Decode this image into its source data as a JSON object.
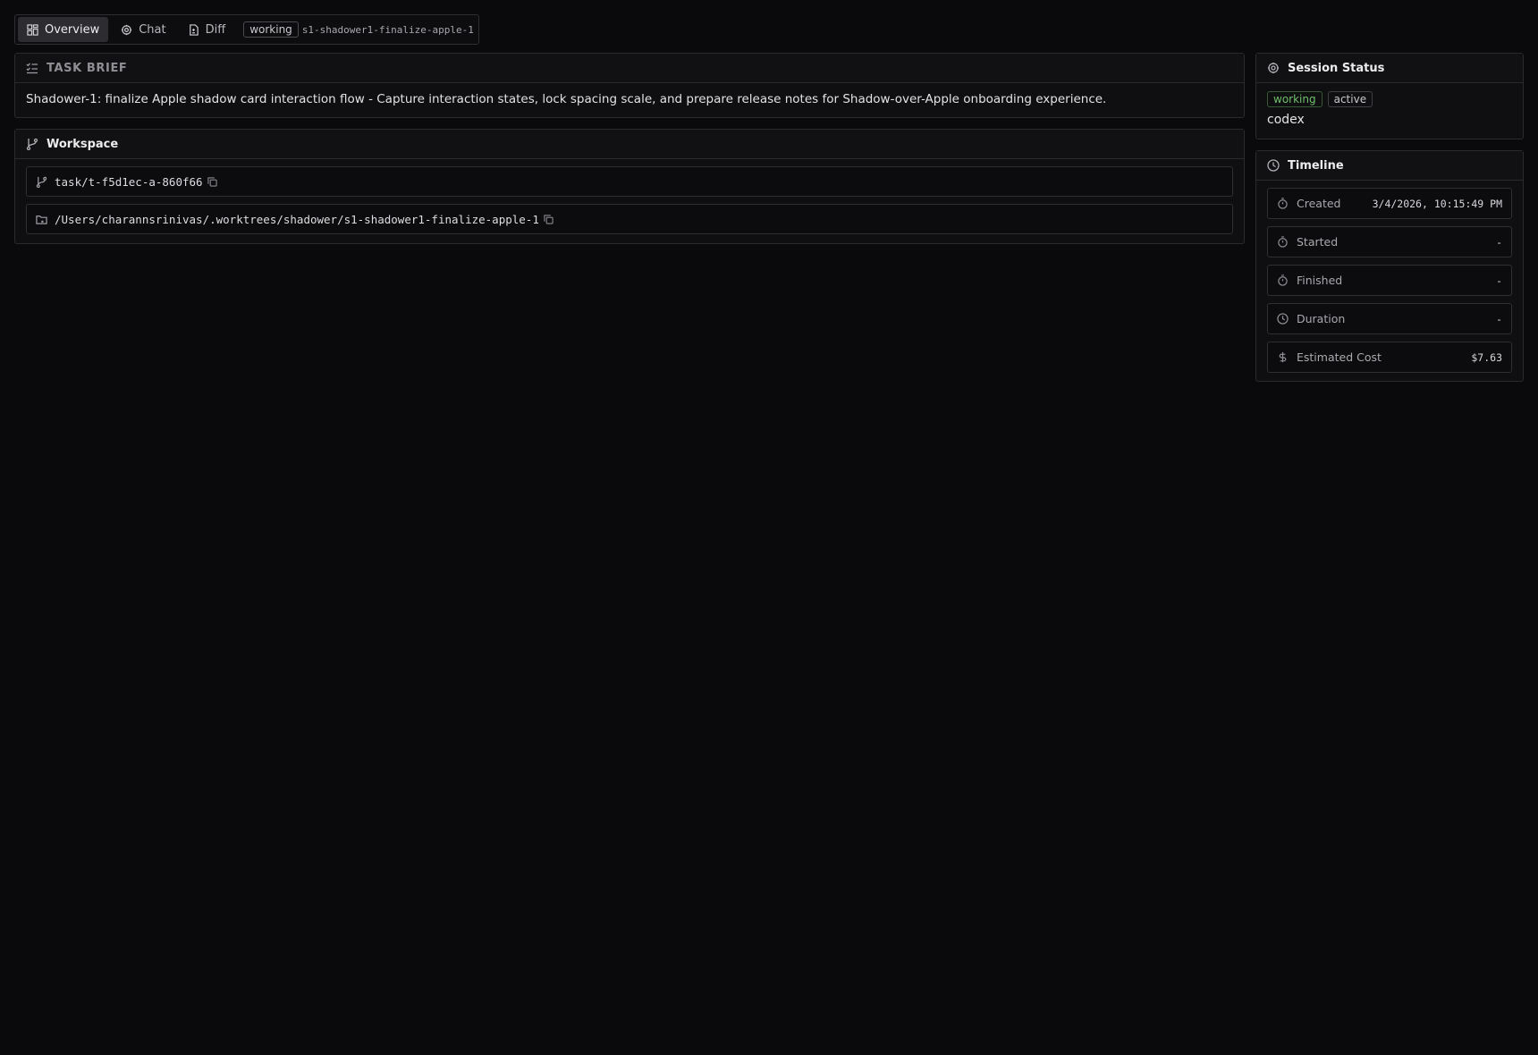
{
  "tabs": {
    "overview": "Overview",
    "chat": "Chat",
    "diff": "Diff",
    "status_badge": "working",
    "branch": "s1-shadower1-finalize-apple-1"
  },
  "task_brief": {
    "title": "TASK BRIEF",
    "text": "Shadower-1: finalize Apple shadow card interaction flow - Capture interaction states, lock spacing scale, and prepare release notes for Shadow-over-Apple onboarding experience."
  },
  "workspace": {
    "title": "Workspace",
    "branch": "task/t-f5d1ec-a-860f66",
    "path": "/Users/charannsrinivas/.worktrees/shadower/s1-shadower1-finalize-apple-1"
  },
  "session_status": {
    "title": "Session Status",
    "badges": [
      "working",
      "active"
    ],
    "agent": "codex"
  },
  "timeline": {
    "title": "Timeline",
    "rows": [
      {
        "label": "Created",
        "value": "3/4/2026, 10:15:49 PM"
      },
      {
        "label": "Started",
        "value": "-"
      },
      {
        "label": "Finished",
        "value": "-"
      },
      {
        "label": "Duration",
        "value": "-"
      },
      {
        "label": "Estimated Cost",
        "value": "$7.63"
      }
    ]
  },
  "colors": {
    "background": "#0a0a0c",
    "working_badge": "#6fbf6a"
  },
  "icons": {
    "overview": "grid-icon",
    "chat": "agent-icon",
    "diff": "file-diff-icon",
    "task_brief": "checklist-icon",
    "workspace": "git-branch-icon",
    "path": "folder-icon",
    "copy": "copy-icon",
    "session_status": "agent-icon",
    "timeline": "clock-icon",
    "created": "stopwatch-icon",
    "cost": "dollar-icon"
  }
}
